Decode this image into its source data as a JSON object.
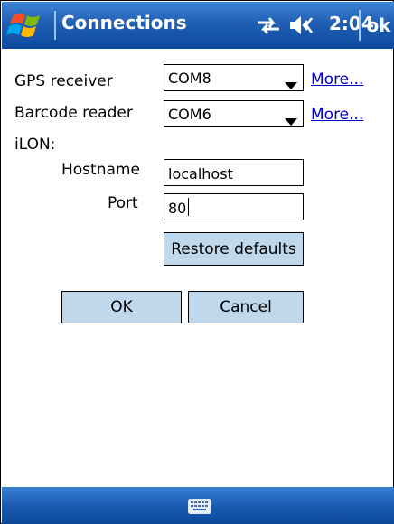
{
  "title_bar": {
    "title": "Connections",
    "clock": "2:04",
    "ok_label": "ok",
    "icons": [
      "windows-start-icon",
      "connectivity-icon",
      "volume-icon"
    ]
  },
  "form": {
    "gps": {
      "label": "GPS receiver",
      "value": "COM8",
      "more": "More..."
    },
    "barcode": {
      "label": "Barcode reader",
      "value": "COM6",
      "more": "More..."
    },
    "ilon_label": "iLON:",
    "hostname": {
      "label": "Hostname",
      "value": "localhost"
    },
    "port": {
      "label": "Port",
      "value": "80"
    },
    "restore_label": "Restore defaults",
    "ok_label": "OK",
    "cancel_label": "Cancel"
  },
  "bottom_bar": {
    "icon": "keyboard-icon"
  },
  "colors": {
    "title_bar": "#1f5fb4",
    "button_face": "#c0d8ec",
    "link": "#0000cc"
  }
}
